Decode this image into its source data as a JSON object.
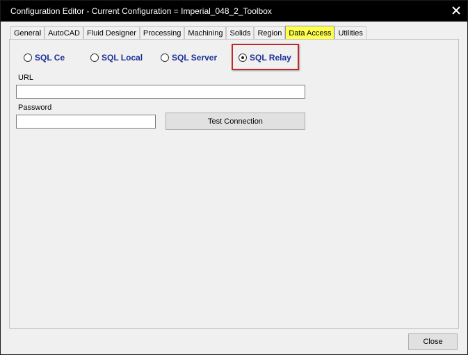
{
  "window": {
    "title": "Configuration Editor - Current Configuration = Imperial_048_2_Toolbox",
    "close_glyph": "✕"
  },
  "tabs": [
    {
      "label": "General",
      "active": false
    },
    {
      "label": "AutoCAD",
      "active": false
    },
    {
      "label": "Fluid Designer",
      "active": false
    },
    {
      "label": "Processing",
      "active": false
    },
    {
      "label": "Machining",
      "active": false
    },
    {
      "label": "Solids",
      "active": false
    },
    {
      "label": "Region",
      "active": false
    },
    {
      "label": "Data Access",
      "active": true
    },
    {
      "label": "Utilities",
      "active": false
    }
  ],
  "data_access": {
    "options": [
      {
        "label": "SQL Ce",
        "selected": false
      },
      {
        "label": "SQL Local",
        "selected": false
      },
      {
        "label": "SQL Server",
        "selected": false
      },
      {
        "label": "SQL Relay",
        "selected": true
      }
    ],
    "url_label": "URL",
    "url_value": "",
    "password_label": "Password",
    "password_value": "",
    "test_connection_label": "Test Connection"
  },
  "footer": {
    "close_label": "Close"
  },
  "colors": {
    "active_tab": "#ffff4d",
    "radio_label": "#1c2f96",
    "highlight_border": "#c0292a"
  }
}
